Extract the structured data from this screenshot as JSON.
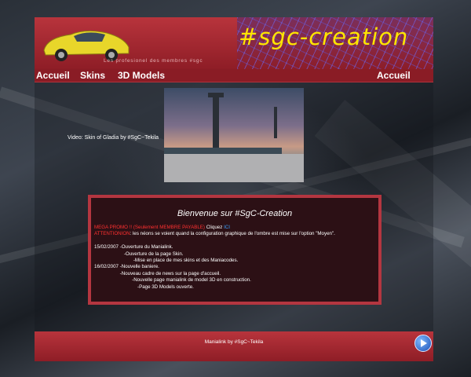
{
  "header": {
    "logo_text": "#sgc-creation",
    "tagline": "Les profesionel des membres #sgc"
  },
  "nav": {
    "items": [
      "Accueil",
      "Skins",
      "3D Models"
    ],
    "right_item": "Accueil"
  },
  "video": {
    "caption": "Video: Skin of Gladia  by #SgC~Tekila"
  },
  "news": {
    "title": "Bienvenue sur #SgC-Creation",
    "promo_red": "MEGA PROMO !! (Seulement MEMBRE PAYABLE)",
    "promo_tail": " Cliquez ",
    "promo_link": "ICI",
    "attention_red": "ATTENTIONION",
    "attention_tail": ": les néons se voient quand la configuration graphique de l'ombre est mise sur l'option \"Moyen\".",
    "entries": [
      "15/02/2007 -Ouverture du Manialink.",
      "                      -Ouverture de la page Skin.",
      "                             -Mise en place de mes skins et des Maniacodes.",
      "16/02/2007 -Nouvelle baniere.",
      "                   -Nouveau cadre de news sur la page d'accueil.",
      "                            -Nouvelle page manialink de model 3D en construction.",
      "                                -Page 3D Models ouverte."
    ]
  },
  "footer": {
    "text": "Manialink by #SgC~Tekila",
    "play_icon": "play-icon"
  },
  "colors": {
    "banner_red": "#b8343c",
    "logo_yellow": "#ffe600",
    "alert_red": "#ff3030",
    "link_blue": "#3aa0ff"
  }
}
